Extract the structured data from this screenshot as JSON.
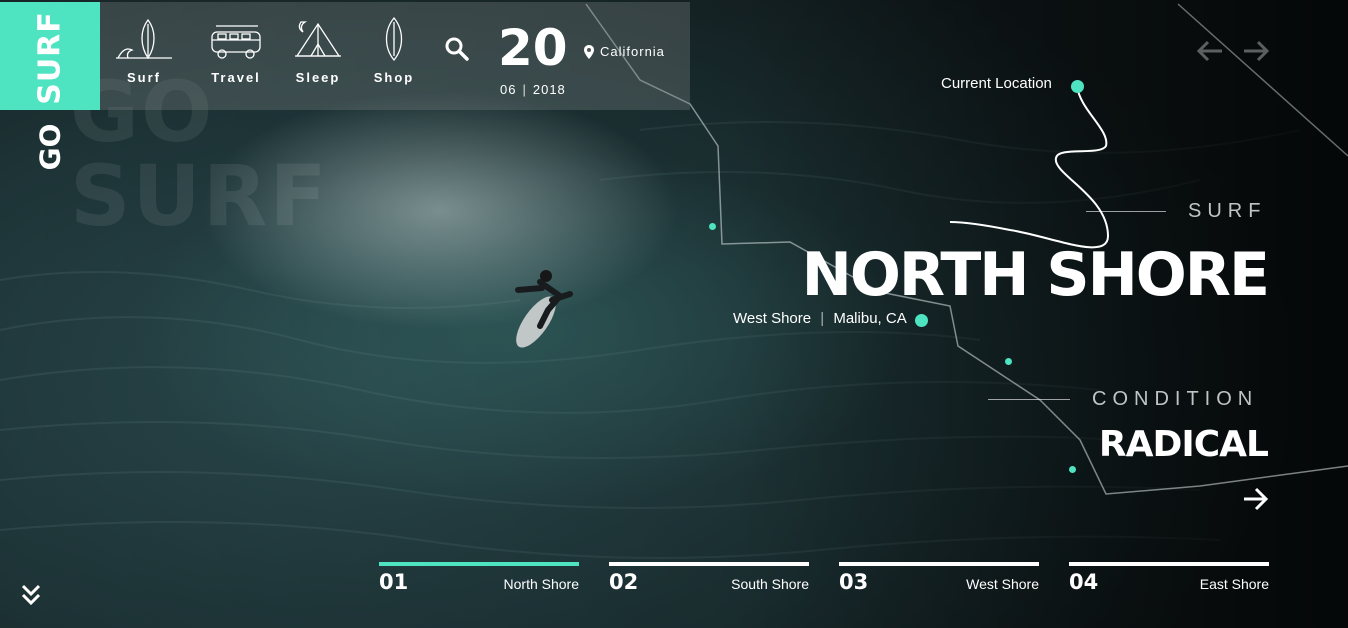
{
  "brand": {
    "top": "SURF",
    "bottom": "GO",
    "watermark": "GO SURF"
  },
  "nav": {
    "items": [
      {
        "label": "Surf",
        "icon": "surfboard-wave-icon"
      },
      {
        "label": "Travel",
        "icon": "van-icon"
      },
      {
        "label": "Sleep",
        "icon": "tent-icon"
      },
      {
        "label": "Shop",
        "icon": "surfboard-icon"
      }
    ],
    "search_icon": "search-icon"
  },
  "date": {
    "day": "20",
    "month": "06",
    "year": "2018",
    "separator": "|"
  },
  "location": {
    "text": "California",
    "icon": "pin-icon"
  },
  "map": {
    "current_location": "Current Location",
    "spot": {
      "name": "West Shore",
      "region": "Malibu, CA",
      "separator": "|"
    }
  },
  "headline": {
    "eyebrow": "SURF",
    "title": "NORTH SHORE"
  },
  "condition": {
    "label": "CONDITION",
    "value": "RADICAL"
  },
  "tabs": [
    {
      "num": "01",
      "name": "North Shore",
      "active": true
    },
    {
      "num": "02",
      "name": "South Shore",
      "active": false
    },
    {
      "num": "03",
      "name": "West Shore",
      "active": false
    },
    {
      "num": "04",
      "name": "East Shore",
      "active": false
    }
  ],
  "colors": {
    "accent": "#4ee3c1",
    "text": "#ffffff"
  }
}
